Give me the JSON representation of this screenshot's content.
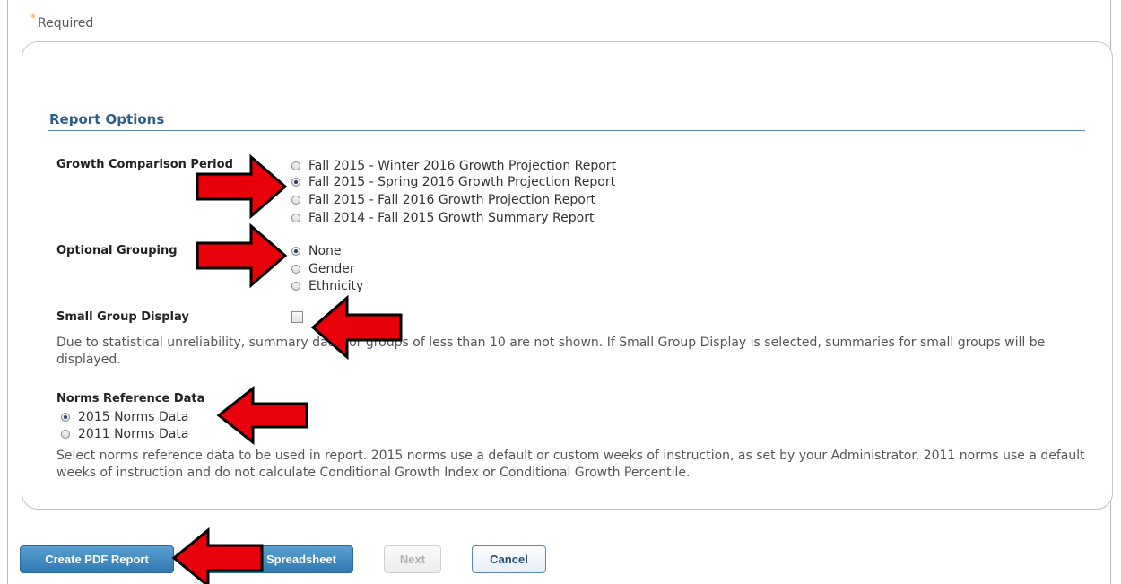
{
  "required_label": "Required",
  "section_title": "Report Options",
  "growth": {
    "label": "Growth Comparison Period",
    "options": [
      "Fall 2015 - Winter 2016 Growth Projection Report",
      "Fall 2015 - Spring 2016 Growth Projection Report",
      "Fall 2015 - Fall 2016 Growth Projection Report",
      "Fall 2014 - Fall 2015 Growth Summary Report"
    ],
    "selected_index": 1
  },
  "grouping": {
    "label": "Optional Grouping",
    "options": [
      "None",
      "Gender",
      "Ethnicity"
    ],
    "selected_index": 0
  },
  "small_group": {
    "label": "Small Group Display",
    "checked": false,
    "description": "Due to statistical unreliability, summary data for groups of less than 10 are not shown. If Small Group Display is selected, summaries for small groups will be displayed."
  },
  "norms": {
    "label": "Norms Reference Data",
    "options": [
      "2015 Norms Data",
      "2011 Norms Data"
    ],
    "selected_index": 0,
    "description": "Select norms reference data to be used in report. 2015 norms use a default or custom weeks of instruction, as set by your Administrator. 2011 norms use a default weeks of instruction and do not calculate Conditional Growth Index or Conditional Growth Percentile."
  },
  "buttons": {
    "create_pdf": "Create PDF Report",
    "spreadsheet": "Spreadsheet",
    "next": "Next",
    "cancel": "Cancel"
  },
  "colors": {
    "accent": "#2c5f8a",
    "button_blue": "#3b86bf",
    "arrow_red": "#e8000b"
  }
}
